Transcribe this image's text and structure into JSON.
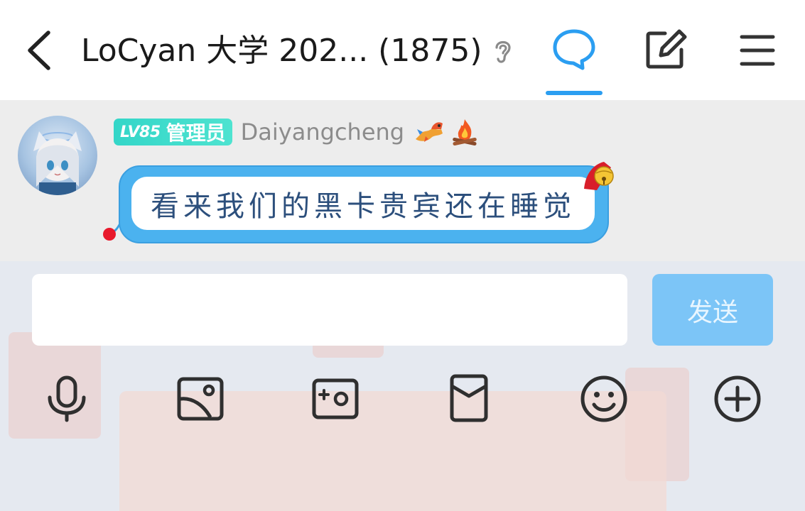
{
  "header": {
    "title": "LoCyan 大学 202... (1875)",
    "icons": [
      "chevron-left-icon",
      "ear-icon",
      "chat-bubble-icon",
      "edit-icon",
      "menu-icon"
    ],
    "active_tab_color": "#2b9ef1"
  },
  "message": {
    "level": "LV85",
    "role": "管理员",
    "sender": "Daiyangcheng",
    "decorations": [
      "dragon-icon",
      "campfire-icon"
    ],
    "text": "看来我们的黑卡贵宾还在睡觉",
    "bubble_color": "#4bb2ef"
  },
  "composer": {
    "input_value": "",
    "send_label": "发送",
    "send_color": "#7cc5f7",
    "tools": [
      "microphone-icon",
      "image-icon",
      "camera-icon",
      "red-packet-icon",
      "emoji-icon",
      "plus-icon"
    ]
  }
}
